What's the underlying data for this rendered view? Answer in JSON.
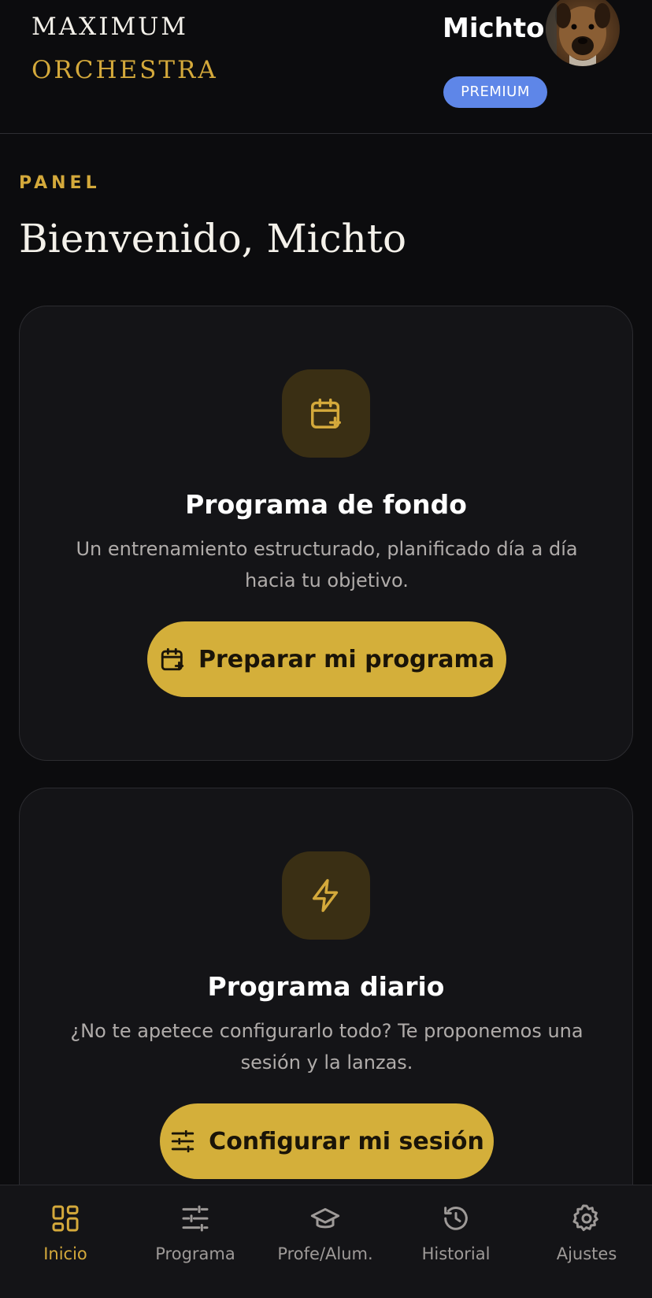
{
  "header": {
    "brand_line1": "MAXIMUM",
    "brand_line2": "ORCHESTRA",
    "user_name": "Michto",
    "badge": "PREMIUM"
  },
  "panel": {
    "eyebrow": "PANEL",
    "welcome": "Bienvenido, Michto"
  },
  "cards": [
    {
      "icon": "calendar-plus-icon",
      "title": "Programa de fondo",
      "description": "Un entrenamiento estructurado, planificado día a día hacia tu objetivo.",
      "cta_label": "Preparar mi programa",
      "cta_icon": "calendar-plus-icon"
    },
    {
      "icon": "lightning-icon",
      "title": "Programa diario",
      "description": "¿No te apetece configurarlo todo? Te proponemos una sesión y la lanzas.",
      "cta_label": "Configurar mi sesión",
      "cta_icon": "sliders-icon"
    }
  ],
  "nav": [
    {
      "label": "Inicio",
      "icon": "grid-icon",
      "active": true
    },
    {
      "label": "Programa",
      "icon": "sliders-icon",
      "active": false
    },
    {
      "label": "Profe/Alum.",
      "icon": "graduation-cap-icon",
      "active": false
    },
    {
      "label": "Historial",
      "icon": "history-icon",
      "active": false
    },
    {
      "label": "Ajustes",
      "icon": "gear-icon",
      "active": false
    }
  ],
  "colors": {
    "background": "#0c0c0e",
    "card": "#141417",
    "accent": "#d4a93b",
    "button": "#d4af3a",
    "badge": "#5e86e8",
    "muted_text": "#b0acaa"
  }
}
